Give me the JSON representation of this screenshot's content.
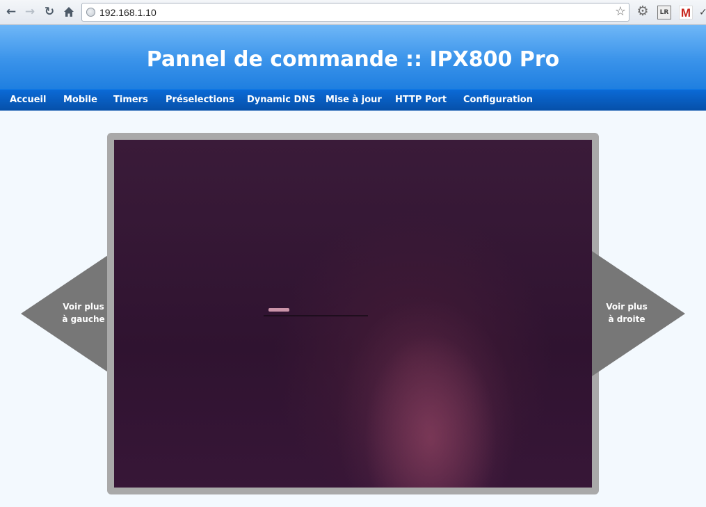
{
  "browser": {
    "url": "192.168.1.10",
    "back_icon": "arrow-left-icon",
    "forward_icon": "arrow-right-icon",
    "reload_icon": "reload-icon",
    "home_icon": "home-icon",
    "bookmark_icon": "star-icon",
    "extensions": [
      "gear-extension-icon",
      "lightroom-extension-icon",
      "gmail-extension-icon"
    ]
  },
  "header": {
    "title": "Pannel de commande :: IPX800 Pro",
    "color_top": "#6fb7f7",
    "color_bottom": "#1f7fe0"
  },
  "nav": {
    "items": [
      {
        "label": "Accueil"
      },
      {
        "label": "Mobile"
      },
      {
        "label": "Timers"
      },
      {
        "label": "Préselections"
      },
      {
        "label": "Dynamic DNS"
      },
      {
        "label": "Mise à jour"
      },
      {
        "label": "HTTP Port"
      },
      {
        "label": "Configuration"
      }
    ],
    "color": "#0650a9"
  },
  "gallery": {
    "prev_label": "Voir plus\nà gauche",
    "next_label": "Voir plus\nà droite",
    "arrow_color": "#777777",
    "frame_color": "#a9a9a9"
  }
}
